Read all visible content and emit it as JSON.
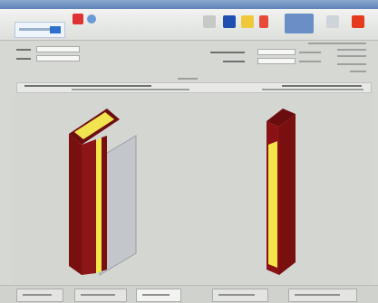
{
  "toolbar": {
    "icons": [
      "app-logo-icon",
      "tool-icon-1",
      "tool-icon-2",
      "tool-icon-3",
      "save-icon",
      "folder-icon",
      "help-icon",
      "view-icon",
      "table-icon",
      "exit-icon"
    ]
  },
  "colors": {
    "panel_red": "#7a0f10",
    "panel_yellow": "#f4e64a",
    "panel_grey": "#c3c7cc",
    "accent_blue": "#3e73c7"
  }
}
